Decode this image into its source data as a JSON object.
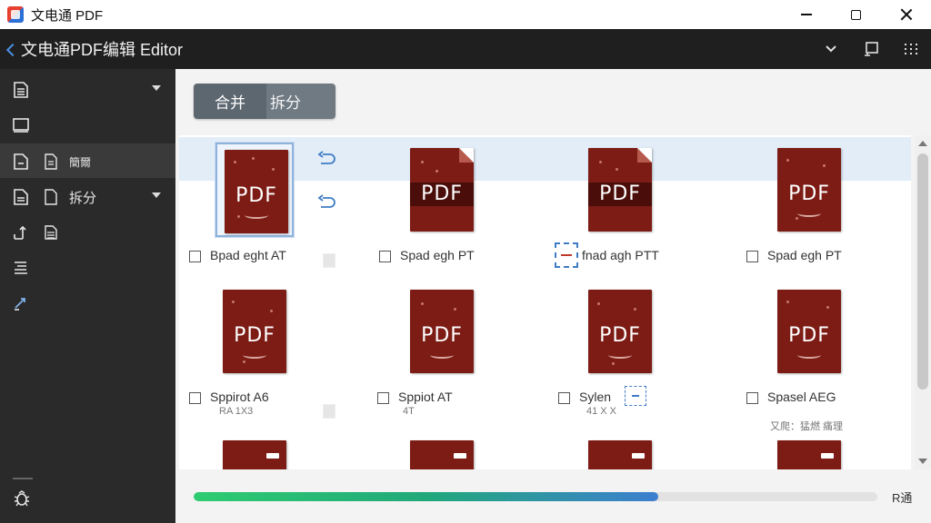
{
  "window": {
    "app_name": "文电通 PDF",
    "controls": [
      "minimize",
      "maximize",
      "close"
    ]
  },
  "header": {
    "title": "文电通PDF编辑 Editor",
    "tools": [
      "chevron-down-icon",
      "export-icon",
      "grid-icon"
    ]
  },
  "sidebar": {
    "items": [
      {
        "icon": "document-icon",
        "label": "",
        "has_caret": true
      },
      {
        "icon": "monitor-icon",
        "label": "",
        "has_caret": false
      },
      {
        "icon": "page-icon",
        "sub_icon": "file-icon",
        "label": "簡爾",
        "active": true
      },
      {
        "icon": "page-lines-icon",
        "sub_icon": "file-icon",
        "label": "拆分",
        "has_caret": true
      },
      {
        "icon": "corner-arrow-icon",
        "sub_icon": "stack-icon",
        "label": ""
      },
      {
        "icon": "list-icon",
        "label": ""
      },
      {
        "icon": "convert-arrow-icon",
        "label": ""
      }
    ],
    "footer_icon": "bug-icon"
  },
  "toolbar": {
    "merge_label": "合并",
    "split_label": "拆分"
  },
  "files": [
    {
      "name": "Bpad eght AT",
      "sub": "",
      "style": "plain",
      "selected": true,
      "checked": false
    },
    {
      "name": "Spad egh PT",
      "sub": "",
      "style": "bar-fold",
      "selected": false,
      "checked": false
    },
    {
      "name": "fnad agh PTT",
      "sub": "",
      "style": "bar-fold",
      "selected": false,
      "checked": false,
      "dashed_check": true
    },
    {
      "name": "Spad egh PT",
      "sub": "",
      "style": "plain",
      "selected": false,
      "checked": false
    },
    {
      "name": "Sppirot A6",
      "sub": "RA    1X3",
      "style": "plain",
      "selected": false,
      "checked": false
    },
    {
      "name": "Sppiot AT",
      "sub": "4T",
      "style": "plain",
      "selected": false,
      "checked": false
    },
    {
      "name": "Sylen",
      "sub": "41  X X",
      "style": "plain",
      "selected": false,
      "checked": false,
      "dashed_after": true
    },
    {
      "name": "Spasel AEG",
      "sub": "又爬：猛燃 痛理",
      "style": "plain",
      "selected": false,
      "checked": false
    }
  ],
  "page_label": "PDF",
  "progress": {
    "value": 0.68,
    "label": "R通"
  },
  "colors": {
    "header_bg": "#1f1f1f",
    "sidebar_bg": "#2a2a2a",
    "accent": "#4a90e2",
    "pdf_page": "#7c1c15",
    "progress_start": "#2ecc71",
    "progress_end": "#3d7fd0"
  }
}
